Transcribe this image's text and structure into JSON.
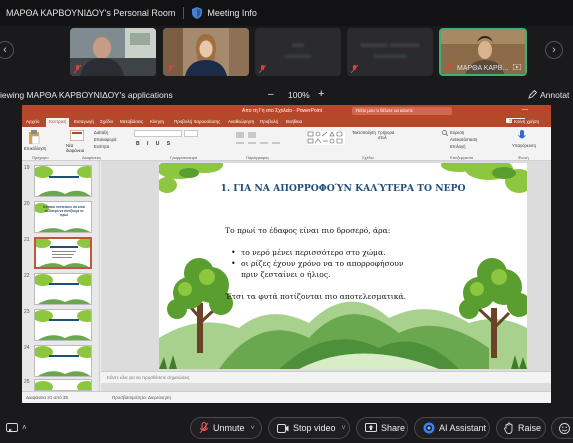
{
  "topbar": {
    "room_title": "ΜΑΡΘΑ ΚΑΡΒΟΥΝΙΔΟΥ's Personal Room",
    "meeting_info": "Meeting Info"
  },
  "participants": [
    {
      "name": ""
    },
    {
      "name": ""
    },
    {
      "name": "",
      "blur1": "xxxx",
      "blur2": "xxxxxxxxx"
    },
    {
      "name": "",
      "blur1": "xxxxxxxxx xxxxxxxxxx",
      "blur2": "xxxxxxxxxxx"
    },
    {
      "name": "ΜΑΡΘΑ ΚΑΡΒ..."
    }
  ],
  "viewbar": {
    "viewing_text": "iewing ΜΑΡΘΑ ΚΑΡΒΟΥΝΙΔΟΥ's applications",
    "zoom_minus": "–",
    "zoom_level": "100%",
    "zoom_plus": "+",
    "annotate": "Annotat"
  },
  "powerpoint": {
    "window_title": "Απο τη Γη στο Σχολείο  -  PowerPoint",
    "search_placeholder": "Πείτε μου τι θέλετε να κάνετε",
    "tabs": [
      "Αρχείο",
      "Κεντρική",
      "Εισαγωγή",
      "Σχέδιο",
      "Μεταβάσεις",
      "Κίνηση",
      "Προβολή παρουσίασης",
      "Αναθεώρηση",
      "Προβολή",
      "Βοήθεια"
    ],
    "share_button": "Κοινή χρήση",
    "comments_button": "Σχόλια",
    "ribbon": {
      "paste": "Επικόλληση",
      "new_slide": "Νέα διαφάνεια",
      "layout": "Διάταξη",
      "reset": "Επαναφορά",
      "section": "Ενότητα",
      "arrange": "Τακτοποίηση",
      "quick_styles": "Γρήγορα στυλ",
      "find": "Εύρεση",
      "replace": "Αντικατάσταση",
      "select": "Επιλογή",
      "dictate": "Υπαγόρευση",
      "group_clipboard": "Πρόχειρο",
      "group_slides": "Διαφάνειες",
      "group_font": "Γραμματοσειρά",
      "group_paragraph": "Παράγραφος",
      "group_drawing": "Σχέδιο",
      "group_editing": "Επεξεργασία",
      "group_voice": "Φωνή"
    },
    "thumbnails": [
      {
        "num": "19"
      },
      {
        "num": "20",
        "text": "Κάποιοι πιστεύουν ότι είναι καλύτερο να ποτίζουμε το πρωί"
      },
      {
        "num": "21"
      },
      {
        "num": "22"
      },
      {
        "num": "23"
      },
      {
        "num": "24"
      },
      {
        "num": "25"
      }
    ],
    "slide": {
      "title": "1. ΓΙΑ ΝΑ ΑΠΟΡΡΟΦΟΎΝ ΚΑΛΎΤΕΡΑ ΤΟ ΝΕΡΟ",
      "intro": "Το πρωί το έδαφος είναι πιο δροσερό, άρα:",
      "bullet1": "το νερό μένει περισσότερο στο χώμα.",
      "bullet2a": "οι ρίζες έχουν χρόνο να το απορροφήσουν",
      "bullet2b": "πριν ζεσταίνει ο ήλιος.",
      "conclusion": "Έτσι τα φυτά ποτίζονται πιο αποτελεσματικά."
    },
    "notes_placeholder": "Κάντε κλικ για να προσθέσετε σημειώσεις",
    "status_left": "Διαφάνεια 21 από 35",
    "status_mid": "Προσβασιμότητα: Διερεύνηση"
  },
  "toolbar": {
    "unmute": "Unmute",
    "stop_video": "Stop video",
    "share": "Share",
    "ai_assistant": "AI Assistant",
    "raise": "Raise"
  },
  "colors": {
    "ppt_accent": "#b7472a",
    "slide_title": "#1f4e79",
    "mute_red": "#e04040"
  }
}
